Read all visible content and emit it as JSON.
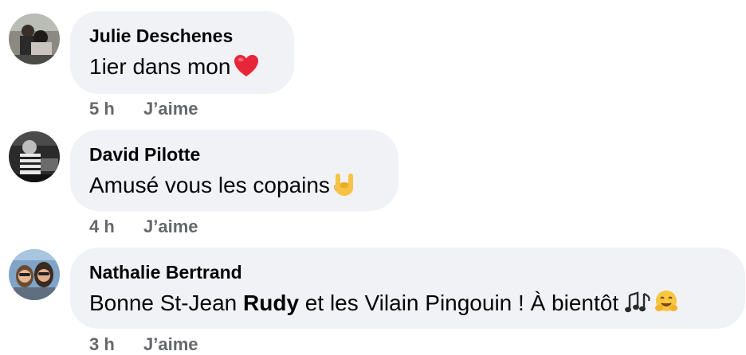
{
  "comments": [
    {
      "author": "Julie Deschenes",
      "text": "1ier dans mon",
      "emoji": "red-heart",
      "time": "5 h",
      "like_label": "J’aime"
    },
    {
      "author": "David Pilotte",
      "text": "Amusé vous les copains",
      "emoji": "rock-hand",
      "time": "4 h",
      "like_label": "J’aime"
    },
    {
      "author": "Nathalie Bertrand",
      "text_before": "Bonne St-Jean ",
      "text_bold": "Rudy",
      "text_after": " et les Vilain Pingouin ! À bientôt ",
      "emojis": [
        "musical-notes",
        "hugging-face"
      ],
      "time": "3 h",
      "like_label": "J’aime"
    }
  ],
  "colors": {
    "bubble": "#f0f2f5",
    "meta_text": "#65676b",
    "text": "#050505",
    "heart": "#e0245e"
  }
}
